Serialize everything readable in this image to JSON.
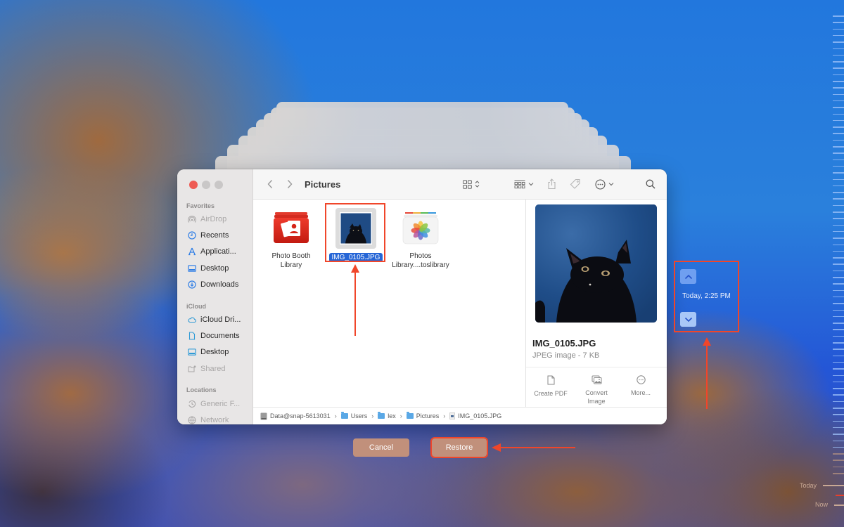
{
  "window": {
    "title": "Pictures",
    "traffic_lights": [
      "close",
      "minimize",
      "maximize"
    ]
  },
  "sidebar": {
    "sections": [
      {
        "heading": "Favorites",
        "items": [
          {
            "label": "AirDrop",
            "icon": "airdrop-icon",
            "dim": true
          },
          {
            "label": "Recents",
            "icon": "clock-icon",
            "dim": false
          },
          {
            "label": "Applicati...",
            "icon": "applications-icon",
            "dim": false
          },
          {
            "label": "Desktop",
            "icon": "desktop-icon",
            "dim": false
          },
          {
            "label": "Downloads",
            "icon": "download-icon",
            "dim": false
          }
        ]
      },
      {
        "heading": "iCloud",
        "items": [
          {
            "label": "iCloud Dri...",
            "icon": "cloud-icon",
            "dim": false
          },
          {
            "label": "Documents",
            "icon": "document-icon",
            "dim": false
          },
          {
            "label": "Desktop",
            "icon": "desktop-icon",
            "dim": false
          },
          {
            "label": "Shared",
            "icon": "shared-folder-icon",
            "dim": true
          }
        ]
      },
      {
        "heading": "Locations",
        "items": [
          {
            "label": "Generic F...",
            "icon": "time-machine-icon",
            "dim": true
          },
          {
            "label": "Network",
            "icon": "globe-icon",
            "dim": true
          }
        ]
      }
    ]
  },
  "toolbar": {
    "back_icon": "chevron-left-icon",
    "forward_icon": "chevron-right-icon",
    "view_icon": "grid-view-icon",
    "group_icon": "group-icon",
    "share_icon": "share-icon",
    "tag_icon": "tag-icon",
    "more_icon": "ellipsis-circle-icon",
    "search_icon": "search-icon"
  },
  "files": [
    {
      "name_line1": "Photo Booth",
      "name_line2": "Library",
      "icon": "photo-booth-library-icon",
      "selected": false
    },
    {
      "name_line1": "IMG_0105.JPG",
      "name_line2": "",
      "icon": "image-thumbnail",
      "selected": true
    },
    {
      "name_line1": "Photos",
      "name_line2": "Library....toslibrary",
      "icon": "photos-library-icon",
      "selected": false
    }
  ],
  "preview": {
    "filename": "IMG_0105.JPG",
    "meta": "JPEG image - 7 KB",
    "actions": [
      {
        "label_line1": "Create PDF",
        "label_line2": "",
        "icon": "pdf-doc-icon"
      },
      {
        "label_line1": "Convert",
        "label_line2": "Image",
        "icon": "convert-image-icon"
      },
      {
        "label_line1": "More...",
        "label_line2": "",
        "icon": "ellipsis-circle-icon"
      }
    ]
  },
  "pathbar": [
    {
      "label": "Data@snap-5613031",
      "icon": "disk-icon"
    },
    {
      "label": "Users",
      "icon": "folder-icon"
    },
    {
      "label": "lex",
      "icon": "home-folder-icon"
    },
    {
      "label": "Pictures",
      "icon": "folder-icon"
    },
    {
      "label": "IMG_0105.JPG",
      "icon": "file-icon"
    }
  ],
  "dialog_buttons": {
    "cancel": "Cancel",
    "restore": "Restore"
  },
  "time_machine": {
    "current_snapshot": "Today, 2:25 PM",
    "up_icon": "chevron-up-icon",
    "down_icon": "chevron-down-icon",
    "timeline_labels": {
      "today": "Today",
      "now": "Now"
    }
  },
  "colors": {
    "annotation": "#f0462a",
    "selection": "#2565d6",
    "button": "#c1907b"
  }
}
